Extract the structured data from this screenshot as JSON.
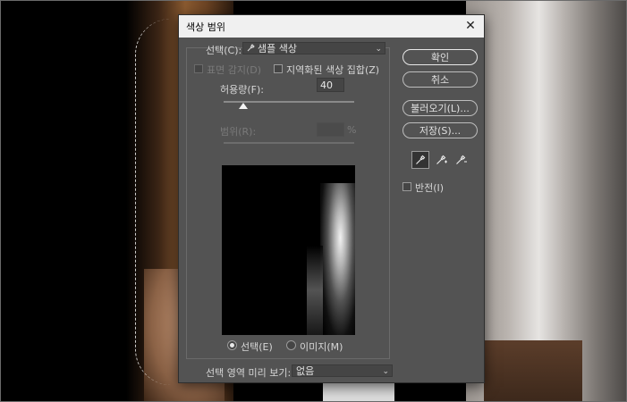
{
  "dialog": {
    "title": "색상 범위",
    "select_label": "선택(C):",
    "select_value": "샘플 색상",
    "detect_faces_label": "표면 감지(D)",
    "localized_label": "지역화된 색상 집합(Z)",
    "fuzziness_label": "허용량(F):",
    "fuzziness_value": "40",
    "fuzziness_level": 0.15,
    "range_label": "범위(R):",
    "range_value": "",
    "range_unit": "%",
    "radio_selection": "선택(E)",
    "radio_image": "이미지(M)",
    "preview_label": "선택 영역 미리 보기:",
    "preview_value": "없음"
  },
  "buttons": {
    "ok": "확인",
    "cancel": "취소",
    "load": "불러오기(L)...",
    "save": "저장(S)..."
  },
  "invert_label": "반전(I)",
  "icons": {
    "close": "close-icon",
    "eyedropper": "eyedropper-icon",
    "eyedropper_plus": "eyedropper-plus-icon",
    "eyedropper_minus": "eyedropper-minus-icon",
    "chevron": "chevron-down-icon"
  }
}
